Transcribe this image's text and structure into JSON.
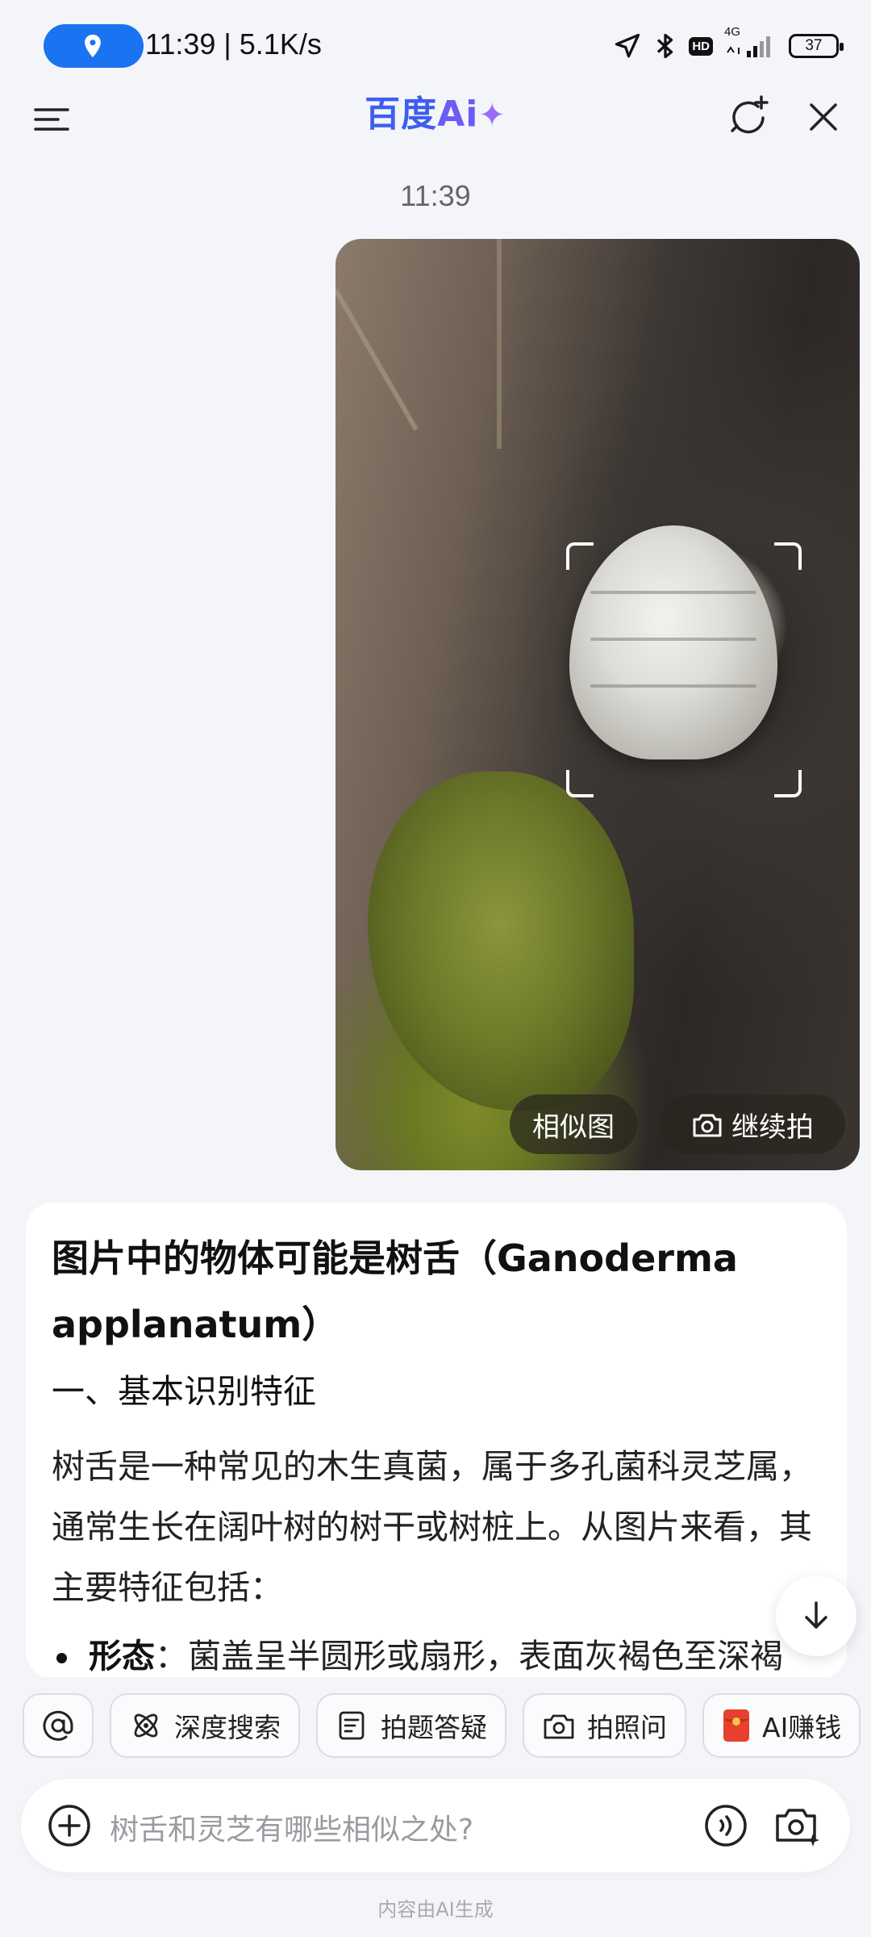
{
  "status_bar": {
    "time_speed": "11:39 | 5.1K/s",
    "network": "4G",
    "hd": "HD",
    "battery": "37"
  },
  "header": {
    "brand_part1": "百度",
    "brand_part2": "Ai",
    "brand_spark": "✦"
  },
  "chat": {
    "timestamp": "11:39",
    "photo_buttons": {
      "similar": "相似图",
      "continue": "继续拍"
    },
    "answer": {
      "title": "图片中的物体可能是树舌（Ganoderma applanatum）",
      "section_heading": "一、基本识别特征",
      "paragraph": "树舌是一种常见的木生真菌，属于多孔菌科灵芝属，通常生长在阔叶树的树干或树桩上。从图片来看，其主要特征包括：",
      "bullet_label": "形态",
      "bullet_text": "：菌盖呈半圆形或扇形，表面灰褐色至深褐"
    }
  },
  "toolbar": {
    "chips": [
      {
        "label": "深度搜索",
        "icon": "atom-icon"
      },
      {
        "label": "拍题答疑",
        "icon": "note-icon"
      },
      {
        "label": "拍照问",
        "icon": "camera-icon"
      },
      {
        "label": "AI赚钱",
        "icon": "red-envelope-icon"
      }
    ]
  },
  "input": {
    "placeholder": "树舌和灵芝有哪些相似之处?"
  },
  "footer": {
    "note": "内容由AI生成"
  }
}
